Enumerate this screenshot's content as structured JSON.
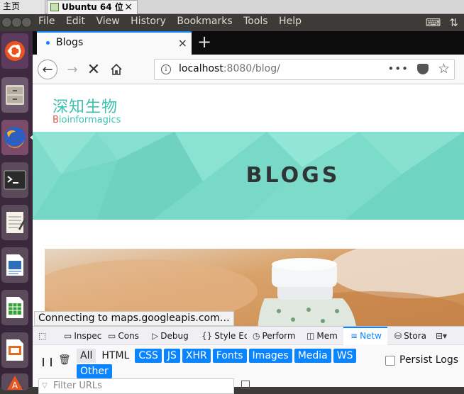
{
  "vm_tabs": {
    "home": "主页",
    "ubuntu": "Ubuntu 64 位",
    "close": "×"
  },
  "menubar": {
    "items": [
      "File",
      "Edit",
      "View",
      "History",
      "Bookmarks",
      "Tools",
      "Help"
    ]
  },
  "browser": {
    "tab_title": "Blogs",
    "tab_close": "×",
    "new_tab": "+",
    "url_host": "localhost",
    "url_rest": ":8080/blog/",
    "url_more": "•••",
    "star": "☆"
  },
  "page": {
    "logo_cn": "深知生物",
    "logo_en_b": "B",
    "logo_en_rest": "ioinformagics",
    "hero_title": "BLOGS",
    "hero_color": "#7fdccb"
  },
  "status_text": "Connecting to maps.googleapis.com…",
  "devtools": {
    "tabs": [
      "Inspec",
      "Cons",
      "Debug",
      "Style Ec",
      "Perform",
      "Mem",
      "Netw",
      "Stora"
    ],
    "filters": [
      "All",
      "HTML",
      "CSS",
      "JS",
      "XHR",
      "Fonts",
      "Images",
      "Media",
      "WS",
      "Other"
    ],
    "persist_logs": "Persist Logs",
    "filter_placeholder": "Filter URLs"
  },
  "colors": {
    "accent": "#0a84ff",
    "launcher": "#3b2a3c",
    "ubuntu_orange": "#e95420"
  }
}
